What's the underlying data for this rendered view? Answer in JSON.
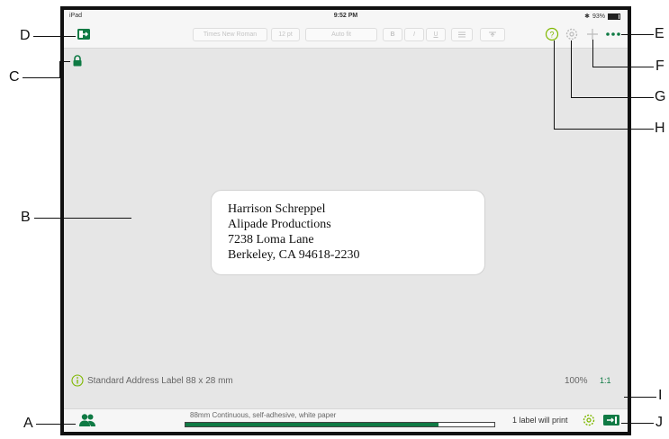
{
  "status_bar": {
    "device": "iPad",
    "time": "9:52 PM",
    "battery": "93%"
  },
  "toolbar": {
    "font_name": "Times New Roman",
    "font_size": "12 pt",
    "fit_mode": "Auto fit",
    "bold": "B",
    "italic": "I",
    "underline": "U",
    "help_icon": "help-circle-icon",
    "settings_icon": "gear-icon",
    "add_icon": "plus-icon",
    "more_icon": "ellipsis-icon"
  },
  "label": {
    "lines": [
      "Harrison Schreppel",
      "Alipade Productions",
      "7238 Loma Lane",
      "Berkeley, CA 94618-2230"
    ]
  },
  "info_bar": {
    "label_type": "Standard Address Label 88 x 28 mm",
    "zoom": "100%",
    "ratio": "1:1"
  },
  "bottom_bar": {
    "media": "88mm Continuous, self-adhesive, white paper",
    "media_remaining": 0.82,
    "print_count": "1 label will print"
  },
  "callouts": [
    "A",
    "B",
    "C",
    "D",
    "E",
    "F",
    "G",
    "H",
    "I",
    "J"
  ],
  "colors": {
    "accent": "#0f7a44",
    "canvas": "#e6e6e6"
  }
}
